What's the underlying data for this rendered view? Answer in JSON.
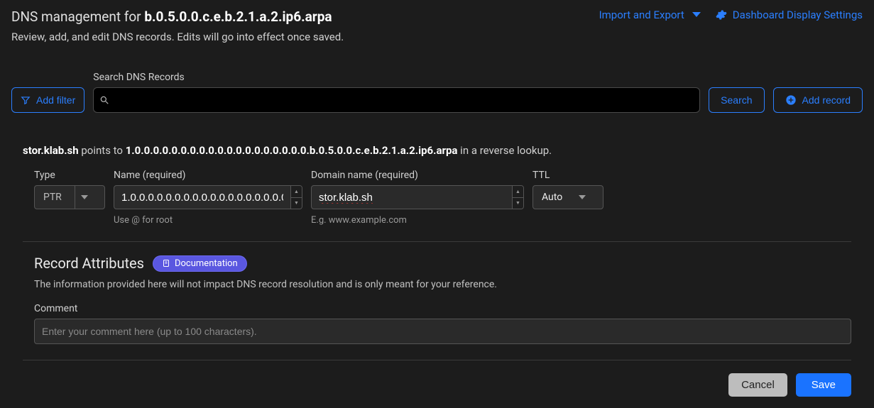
{
  "header": {
    "title_prefix": "DNS management for ",
    "title_domain": "b.0.5.0.0.c.e.b.2.1.a.2.ip6.arpa",
    "subtitle": "Review, add, and edit DNS records. Edits will go into effect once saved.",
    "import_export_label": "Import and Export",
    "settings_label": "Dashboard Display Settings"
  },
  "searchbar": {
    "add_filter_label": "Add filter",
    "search_label": "Search DNS Records",
    "search_value": "",
    "search_button_label": "Search",
    "add_record_label": "Add record"
  },
  "lookup": {
    "host": "stor.klab.sh",
    "mid": " points to ",
    "target": "1.0.0.0.0.0.0.0.0.0.0.0.0.0.0.0.0.0.0.0.b.0.5.0.0.c.e.b.2.1.a.2.ip6.arpa",
    "suffix": " in a reverse lookup."
  },
  "form": {
    "type_label": "Type",
    "type_value": "PTR",
    "name_label": "Name (required)",
    "name_value": "1.0.0.0.0.0.0.0.0.0.0.0.0.0.0.0.0.0.0.0",
    "name_hint": "Use @ for root",
    "domain_label": "Domain name (required)",
    "domain_value": "stor.klab.sh",
    "domain_hint": "E.g. www.example.com",
    "ttl_label": "TTL",
    "ttl_value": "Auto"
  },
  "attributes": {
    "heading": "Record Attributes",
    "doc_label": "Documentation",
    "description": "The information provided here will not impact DNS record resolution and is only meant for your reference.",
    "comment_label": "Comment",
    "comment_placeholder": "Enter your comment here (up to 100 characters).",
    "comment_value": ""
  },
  "footer": {
    "cancel_label": "Cancel",
    "save_label": "Save"
  }
}
